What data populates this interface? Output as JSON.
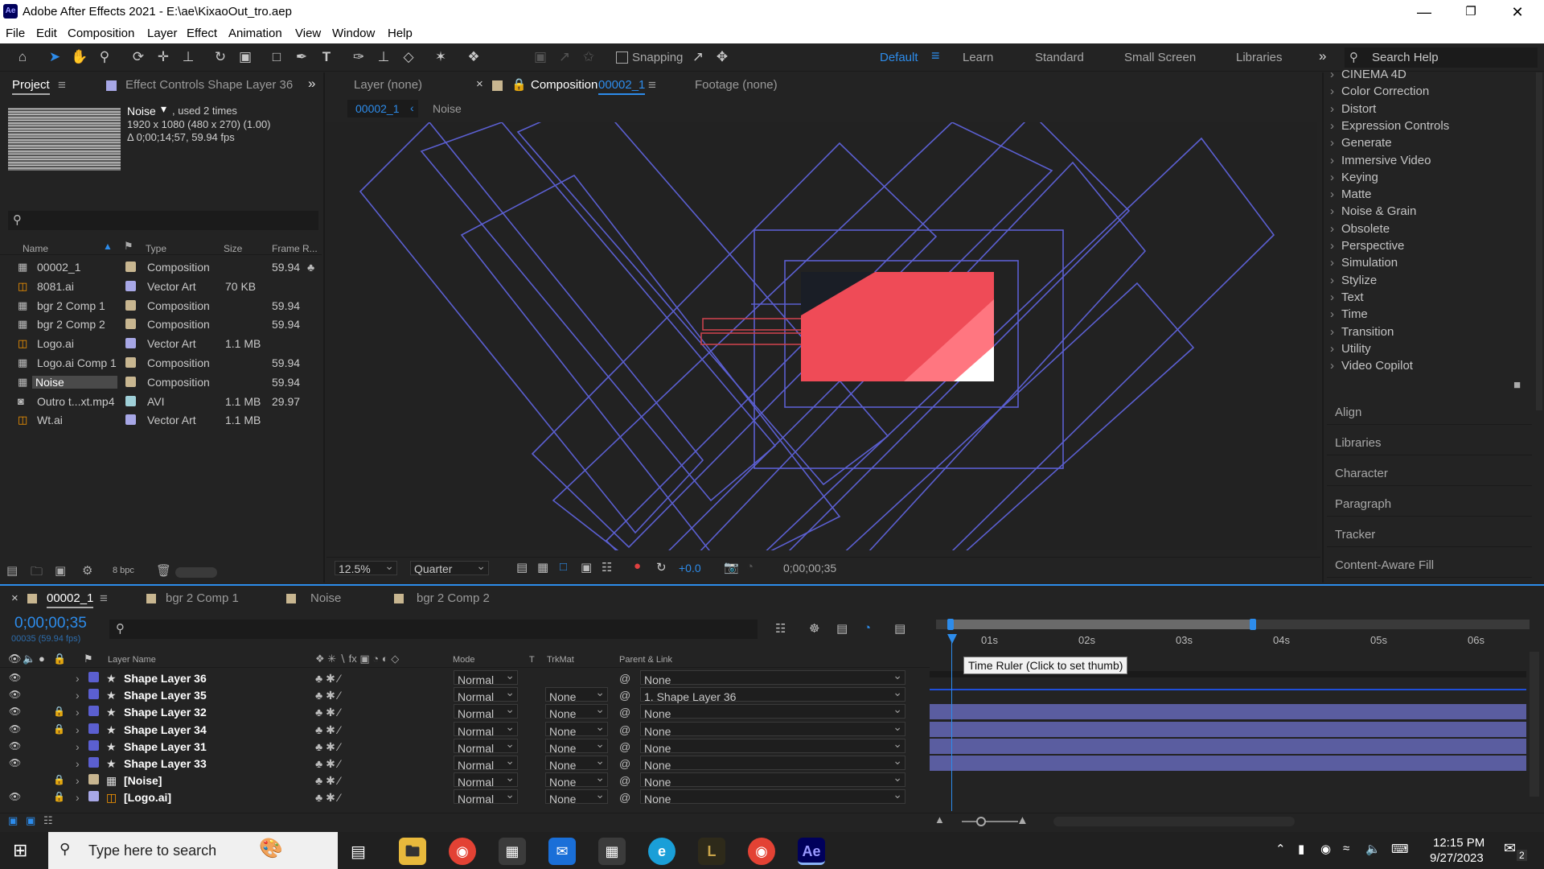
{
  "window": {
    "title": "Adobe After Effects 2021 - E:\\ae\\KixaoOut_tro.aep",
    "app_icon": "Ae"
  },
  "menu": [
    "File",
    "Edit",
    "Composition",
    "Layer",
    "Effect",
    "Animation",
    "View",
    "Window",
    "Help"
  ],
  "toolbar": {
    "snapping_label": "Snapping",
    "workspaces": [
      "Default",
      "Learn",
      "Standard",
      "Small Screen",
      "Libraries"
    ],
    "search_placeholder": "Search Help"
  },
  "project_panel": {
    "tab_project": "Project",
    "tab_effect_controls": "Effect Controls Shape Layer 36",
    "selected_name": "Noise",
    "used": ", used 2 times",
    "dims": "1920 x 1080  (480 x 270) (1.00)",
    "duration": "Δ 0;00;14;57, 59.94 fps",
    "columns": [
      "Name",
      "Type",
      "Size",
      "Frame R..."
    ],
    "items": [
      {
        "name": "00002_1",
        "type": "Composition",
        "size": "",
        "fps": "59.94",
        "kind": "comp",
        "color": "#c8b690"
      },
      {
        "name": "8081.ai",
        "type": "Vector Art",
        "size": "70 KB",
        "fps": "",
        "kind": "ai",
        "color": "#a7a7e6"
      },
      {
        "name": "bgr 2 Comp 1",
        "type": "Composition",
        "size": "",
        "fps": "59.94",
        "kind": "comp",
        "color": "#c8b690"
      },
      {
        "name": "bgr 2 Comp 2",
        "type": "Composition",
        "size": "",
        "fps": "59.94",
        "kind": "comp",
        "color": "#c8b690"
      },
      {
        "name": "Logo.ai",
        "type": "Vector Art",
        "size": "1.1 MB",
        "fps": "",
        "kind": "ai",
        "color": "#a7a7e6"
      },
      {
        "name": "Logo.ai Comp 1",
        "type": "Composition",
        "size": "",
        "fps": "59.94",
        "kind": "comp",
        "color": "#c8b690"
      },
      {
        "name": "Noise",
        "type": "Composition",
        "size": "",
        "fps": "59.94",
        "kind": "comp",
        "color": "#c8b690"
      },
      {
        "name": "Outro t...xt.mp4",
        "type": "AVI",
        "size": "1.1 MB",
        "fps": "29.97",
        "kind": "video",
        "color": "#9fd0d8"
      },
      {
        "name": "Wt.ai",
        "type": "Vector Art",
        "size": "1.1 MB",
        "fps": "",
        "kind": "ai",
        "color": "#a7a7e6"
      }
    ],
    "bpc": "8 bpc"
  },
  "viewer": {
    "tab_layer": "Layer  (none)",
    "tab_comp_prefix": "Composition",
    "tab_comp_name": "00002_1",
    "tab_footage": "Footage  (none)",
    "breadcrumb_1": "00002_1",
    "breadcrumb_2": "Noise",
    "zoom": "12.5%",
    "resolution": "Quarter",
    "exposure": "+0.0",
    "timecode": "0;00;00;35"
  },
  "effects_panel": {
    "items": [
      "CINEMA 4D",
      "Color Correction",
      "Distort",
      "Expression Controls",
      "Generate",
      "Immersive Video",
      "Keying",
      "Matte",
      "Noise & Grain",
      "Obsolete",
      "Perspective",
      "Simulation",
      "Stylize",
      "Text",
      "Time",
      "Transition",
      "Utility",
      "Video Copilot"
    ],
    "panels": [
      "Align",
      "Libraries",
      "Character",
      "Paragraph",
      "Tracker",
      "Content-Aware Fill"
    ]
  },
  "timeline": {
    "tabs": [
      "00002_1",
      "bgr 2 Comp 1",
      "Noise",
      "bgr 2 Comp 2"
    ],
    "timecode": "0;00;00;35",
    "frame_info": "00035 (59.94 fps)",
    "columns": {
      "layer_name": "Layer Name",
      "mode": "Mode",
      "t": "T",
      "trkmat": "TrkMat",
      "parent": "Parent & Link"
    },
    "ruler": [
      "01s",
      "02s",
      "03s",
      "04s",
      "05s",
      "06s"
    ],
    "tooltip": "Time Ruler (Click to set thumb)",
    "layers": [
      {
        "name": "Shape Layer 36",
        "mode": "Normal",
        "trkmat": "",
        "parent": "None",
        "locked": false,
        "kind": "shape"
      },
      {
        "name": "Shape Layer 35",
        "mode": "Normal",
        "trkmat": "None",
        "parent": "1. Shape Layer 36",
        "locked": false,
        "kind": "shape"
      },
      {
        "name": "Shape Layer 32",
        "mode": "Normal",
        "trkmat": "None",
        "parent": "None",
        "locked": true,
        "kind": "shape"
      },
      {
        "name": "Shape Layer 34",
        "mode": "Normal",
        "trkmat": "None",
        "parent": "None",
        "locked": true,
        "kind": "shape"
      },
      {
        "name": "Shape Layer 31",
        "mode": "Normal",
        "trkmat": "None",
        "parent": "None",
        "locked": false,
        "kind": "shape"
      },
      {
        "name": "Shape Layer 33",
        "mode": "Normal",
        "trkmat": "None",
        "parent": "None",
        "locked": false,
        "kind": "shape"
      },
      {
        "name": "[Noise]",
        "mode": "Normal",
        "trkmat": "None",
        "parent": "None",
        "locked": true,
        "kind": "comp"
      },
      {
        "name": "[Logo.ai]",
        "mode": "Normal",
        "trkmat": "None",
        "parent": "None",
        "locked": true,
        "kind": "ai"
      }
    ]
  },
  "taskbar": {
    "search_placeholder": "Type here to search",
    "time": "12:15 PM",
    "date": "9/27/2023",
    "notifications": "2"
  }
}
